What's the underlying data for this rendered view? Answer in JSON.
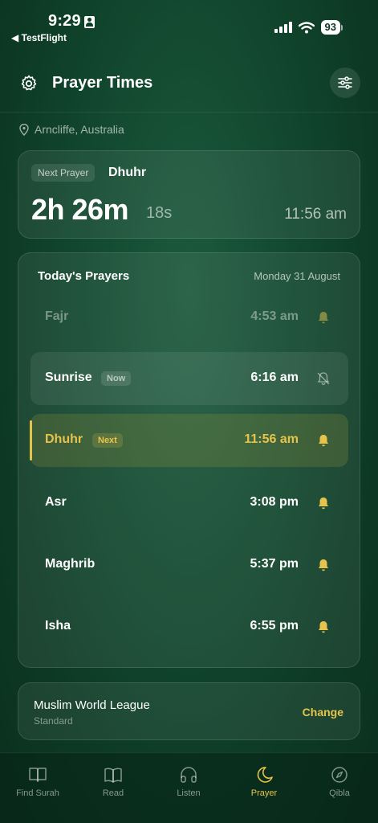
{
  "status_bar": {
    "time": "9:29",
    "back_label": "◀ TestFlight",
    "battery": "93"
  },
  "header": {
    "title": "Prayer Times"
  },
  "location": "Arncliffe, Australia",
  "next_prayer": {
    "label": "Next Prayer",
    "name": "Dhuhr",
    "countdown": "2h 26m",
    "countdown_seconds": "18s",
    "time": "11:56 am"
  },
  "todays_prayers": {
    "title": "Today's Prayers",
    "date": "Monday 31 August",
    "items": [
      {
        "name": "Fajr",
        "time": "4:53 am",
        "state": "past",
        "bell": "on"
      },
      {
        "name": "Sunrise",
        "time": "6:16 am",
        "state": "now",
        "badge": "Now",
        "bell": "off"
      },
      {
        "name": "Dhuhr",
        "time": "11:56 am",
        "state": "next",
        "badge": "Next",
        "bell": "on"
      },
      {
        "name": "Asr",
        "time": "3:08 pm",
        "state": "upcoming",
        "bell": "on"
      },
      {
        "name": "Maghrib",
        "time": "5:37 pm",
        "state": "upcoming",
        "bell": "on"
      },
      {
        "name": "Isha",
        "time": "6:55 pm",
        "state": "upcoming",
        "bell": "on"
      }
    ]
  },
  "calculation_method": {
    "name": "Muslim World League",
    "subtitle": "Standard",
    "change_label": "Change"
  },
  "tabs": [
    {
      "label": "Find Surah",
      "icon": "book-open-icon"
    },
    {
      "label": "Read",
      "icon": "book-icon"
    },
    {
      "label": "Listen",
      "icon": "headphones-icon"
    },
    {
      "label": "Prayer",
      "icon": "moon-icon",
      "active": true
    },
    {
      "label": "Qibla",
      "icon": "compass-icon"
    }
  ],
  "colors": {
    "accent": "#e6c44b",
    "background": "#134a30"
  }
}
